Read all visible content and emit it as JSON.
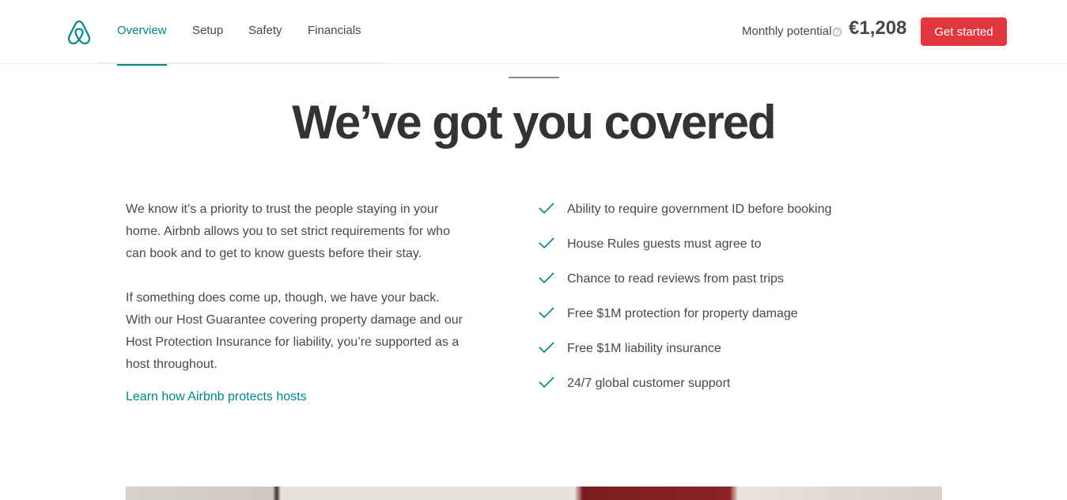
{
  "header": {
    "nav": [
      "Overview",
      "Setup",
      "Safety",
      "Financials"
    ],
    "active_nav": "Overview",
    "potential_label": "Monthly potential",
    "help_glyph": "?",
    "potential_amount": "€1,208",
    "cta_label": "Get started"
  },
  "main": {
    "headline": "We’ve got you covered",
    "intro_paragraphs": [
      "We know it’s a priority to trust the people staying in your home. Airbnb allows you to set strict requirements for who can book and to get to know guests before their stay.",
      "If something does come up, though, we have your back. With our Host Guarantee covering property damage and our Host Protection Insurance for liability, you’re supported as a host throughout."
    ],
    "link_label": "Learn how Airbnb protects hosts",
    "features": [
      "Ability to require government ID before booking",
      "House Rules guests must agree to",
      "Chance to read reviews from past trips",
      "Free $1M protection for property damage",
      "Free $1M liability insurance",
      "24/7 global customer support"
    ]
  },
  "colors": {
    "brand_teal": "#00848a",
    "cta_red": "#e0373f",
    "text": "#484848",
    "headline": "#333333"
  },
  "icons": {
    "logo": "airbnb-logo-icon",
    "check": "check-icon",
    "help": "help-circle-icon"
  }
}
